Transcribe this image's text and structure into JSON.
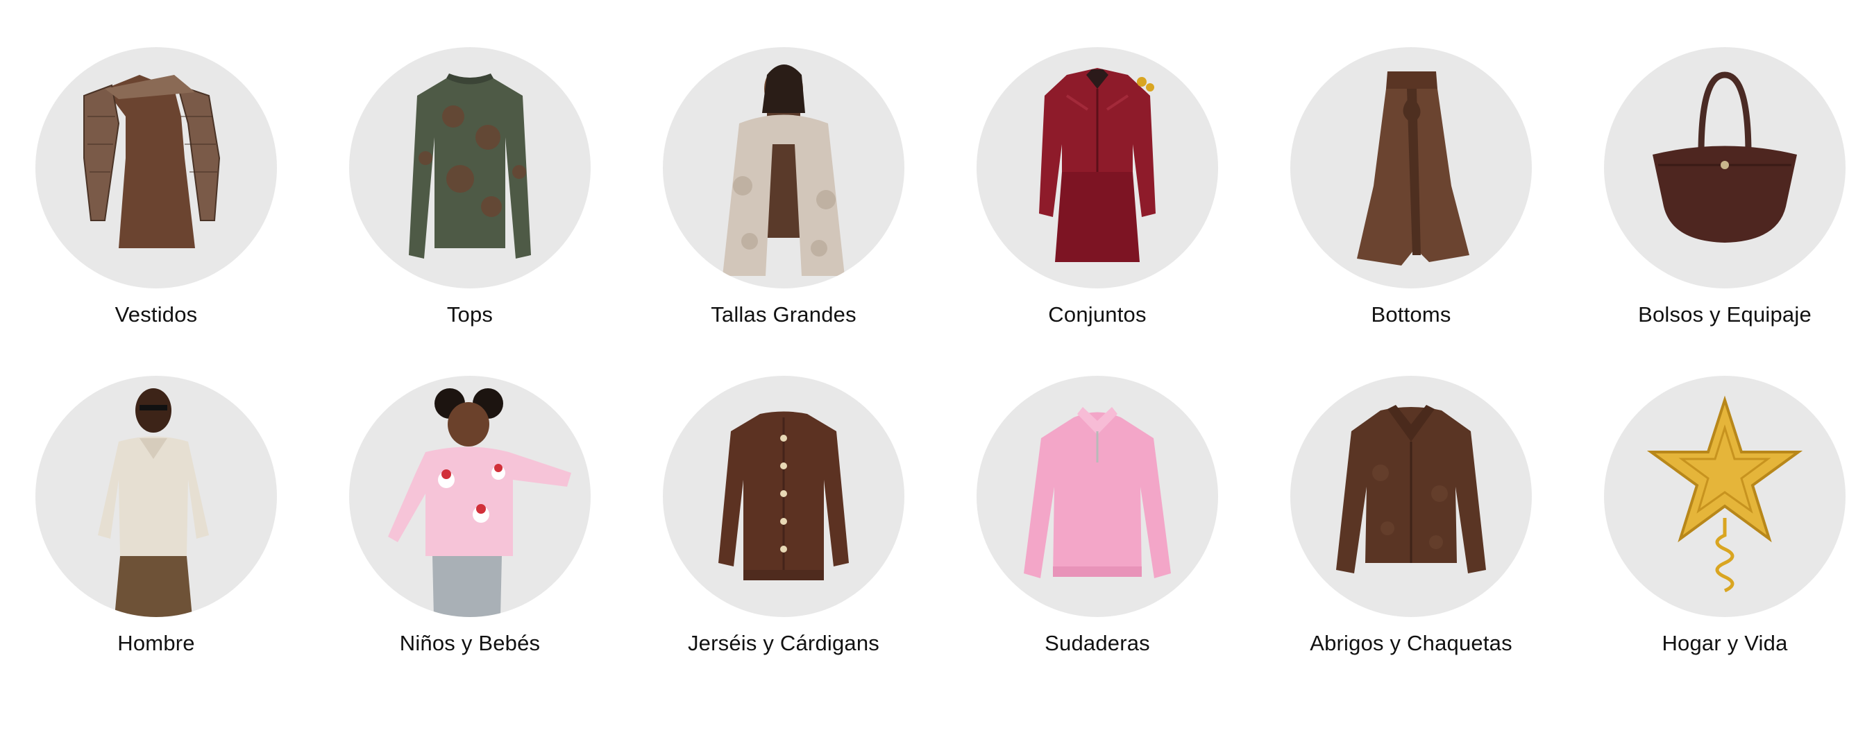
{
  "categories": [
    {
      "label": "Vestidos",
      "icon": "dress-icon"
    },
    {
      "label": "Tops",
      "icon": "top-icon"
    },
    {
      "label": "Tallas Grandes",
      "icon": "plus-size-coat-icon"
    },
    {
      "label": "Conjuntos",
      "icon": "matching-set-icon"
    },
    {
      "label": "Bottoms",
      "icon": "skirt-icon"
    },
    {
      "label": "Bolsos y Equipaje",
      "icon": "handbag-icon"
    },
    {
      "label": "Hombre",
      "icon": "menswear-icon"
    },
    {
      "label": "Niños y Bebés",
      "icon": "kids-sweater-icon"
    },
    {
      "label": "Jerséis y Cárdigans",
      "icon": "cardigan-icon"
    },
    {
      "label": "Sudaderas",
      "icon": "sweatshirt-icon"
    },
    {
      "label": "Abrigos y Chaquetas",
      "icon": "fur-jacket-icon"
    },
    {
      "label": "Hogar y Vida",
      "icon": "star-tree-topper-icon"
    }
  ],
  "colors": {
    "circle_bg": "#e8e8e8",
    "text": "#111111",
    "brown": "#6b4430",
    "burgundy": "#8e1b2a",
    "pink": "#f3a6c8",
    "gold": "#d9a521"
  }
}
